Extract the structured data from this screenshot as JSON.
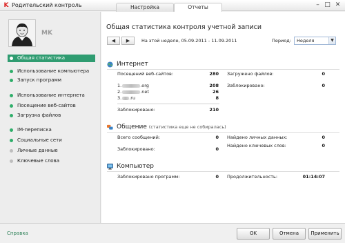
{
  "window": {
    "title": "Родительский контроль",
    "icon": "kaspersky-k-icon",
    "controls": [
      "minimize",
      "maximize",
      "close"
    ]
  },
  "tabs": [
    {
      "label": "Настройка",
      "active": false
    },
    {
      "label": "Отчеты",
      "active": true
    }
  ],
  "user": {
    "name": "MK"
  },
  "sidebar": {
    "items": [
      {
        "label": "Общая статистика",
        "active": true,
        "dot": "green"
      },
      {
        "label": "Использование компьютера",
        "active": false,
        "dot": "green"
      },
      {
        "label": "Запуск программ",
        "active": false,
        "dot": "green"
      },
      {
        "label": "Использование интернета",
        "active": false,
        "dot": "green"
      },
      {
        "label": "Посещение веб-сайтов",
        "active": false,
        "dot": "green"
      },
      {
        "label": "Загрузка файлов",
        "active": false,
        "dot": "green"
      },
      {
        "label": "IM-переписка",
        "active": false,
        "dot": "green"
      },
      {
        "label": "Социальные сети",
        "active": false,
        "dot": "green"
      },
      {
        "label": "Личные данные",
        "active": false,
        "dot": "grey"
      },
      {
        "label": "Ключевые слова",
        "active": false,
        "dot": "grey"
      }
    ]
  },
  "main": {
    "title": "Общая статистика контроля учетной записи",
    "range_text": "На этой неделе, 05.09.2011 - 11.09.2011",
    "period_label": "Период:",
    "period_value": "Неделя"
  },
  "internet": {
    "heading": "Интернет",
    "visits_label": "Посещений веб-сайтов:",
    "visits_value": "280",
    "sites": [
      {
        "prefix": "1.",
        "suffix": ".org",
        "count": "208"
      },
      {
        "prefix": "2.",
        "suffix": ".net",
        "count": "26"
      },
      {
        "prefix": "3.",
        "suffix": ".ru",
        "count": "8"
      }
    ],
    "blocked_label": "Заблокировано:",
    "blocked_value": "210",
    "downloads_label": "Загружено файлов:",
    "downloads_value": "0",
    "downloads_blocked_label": "Заблокировано:",
    "downloads_blocked_value": "0"
  },
  "communication": {
    "heading": "Общение",
    "subheading": "(статистика еще не собиралась)",
    "messages_label": "Всего сообщений:",
    "messages_value": "0",
    "blocked_label": "Заблокировано:",
    "blocked_value": "0",
    "personal_label": "Найдено личных данных:",
    "personal_value": "0",
    "keywords_label": "Найдено ключевых слов:",
    "keywords_value": "0"
  },
  "computer": {
    "heading": "Компьютер",
    "blocked_programs_label": "Заблокировано программ:",
    "blocked_programs_value": "0",
    "duration_label": "Продолжительность:",
    "duration_value": "01:14:07"
  },
  "footer": {
    "help": "Справка",
    "ok": "OK",
    "cancel": "Отмена",
    "apply": "Применить"
  },
  "colors": {
    "accent": "#2f9c71",
    "dot_green": "#2fae6a",
    "dot_grey": "#bdbdbd",
    "link": "#2a7f55"
  }
}
